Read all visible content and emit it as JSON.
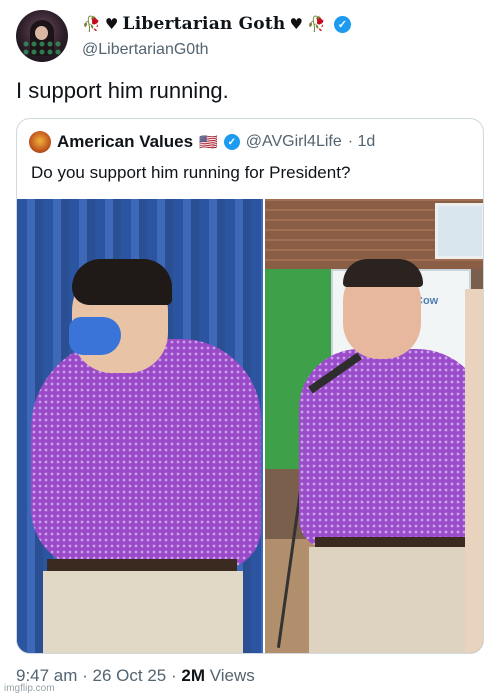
{
  "post": {
    "author": {
      "display_name": "Libertarian Goth",
      "handle": "@LibertarianG0th",
      "verified": true,
      "name_decorations": [
        "rose-icon",
        "black-heart-icon"
      ]
    },
    "text": "I support him running.",
    "timestamp": "9:47 am · 26 Oct 25 · ",
    "views_count": "2M",
    "views_label": " Views"
  },
  "quoted_post": {
    "author": {
      "display_name": "American Values",
      "flag": "🇺🇸",
      "handle": "@AVGirl4Life",
      "age": "· 1d",
      "verified": true
    },
    "text": "Do you support him running for President?",
    "images": [
      {
        "name": "left-photo",
        "description_icon": "man-purple-shirt-mask-photo"
      },
      {
        "name": "right-photo",
        "description_icon": "man-purple-shirt-microphone-photo",
        "sign_text": "Cow"
      }
    ]
  },
  "watermark": "imgflip.com",
  "colors": {
    "accent": "#1d9bf0",
    "text": "#0f1419",
    "muted": "#536471",
    "border": "#cfd9de"
  }
}
